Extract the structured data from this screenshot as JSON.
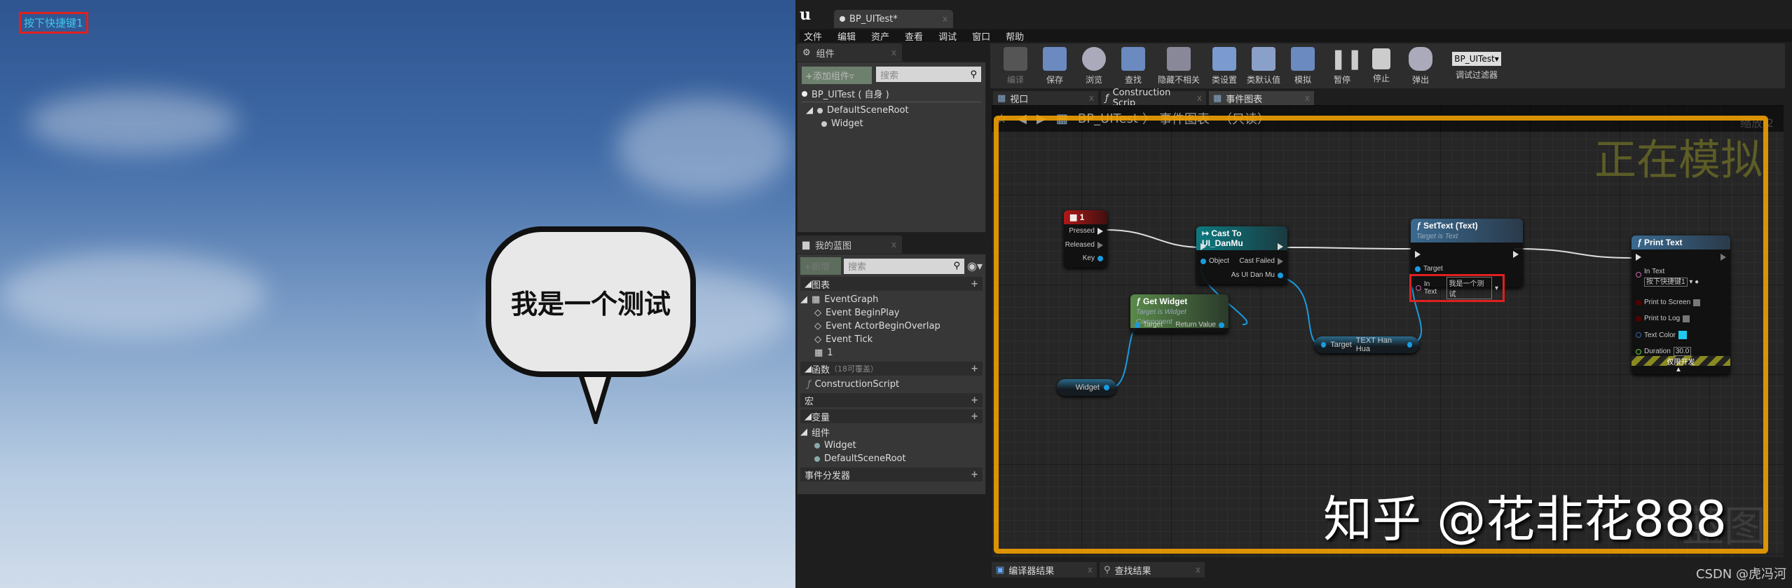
{
  "viewport": {
    "hint_text": "按下快捷键1",
    "bubble_text": "我是一个测试"
  },
  "editor": {
    "window_tab": "BP_UITest*",
    "menu": [
      "文件",
      "编辑",
      "资产",
      "查看",
      "调试",
      "窗口",
      "帮助"
    ],
    "components_panel": {
      "tab": "组件",
      "add_button": "+添加组件▿",
      "search_placeholder": "搜索",
      "self_item": "BP_UITest ( 自身 )",
      "tree": [
        "DefaultSceneRoot",
        "Widget"
      ]
    },
    "blueprint_panel": {
      "tab": "我的蓝图",
      "add_button": "+新增",
      "search_placeholder": "搜索",
      "sections": {
        "graphs": "图表",
        "functions": "函数",
        "functions_note": "（18可覆盖）",
        "macros": "宏",
        "variables": "变量",
        "components": "组件",
        "dispatchers": "事件分发器"
      },
      "graph_items": [
        "EventGraph",
        "Event BeginPlay",
        "Event ActorBeginOverlap",
        "Event Tick",
        "1"
      ],
      "function_items": [
        "ConstructionScript"
      ],
      "component_items": [
        "Widget",
        "DefaultSceneRoot"
      ]
    },
    "toolbar": {
      "buttons": [
        "编译",
        "保存",
        "浏览",
        "查找",
        "隐藏不相关",
        "类设置",
        "类默认值",
        "模拟",
        "暂停",
        "停止",
        "弹出"
      ],
      "debug_object": "BP_UITest▾",
      "debug_filter": "调试过滤器"
    },
    "doc_tabs": [
      "视口",
      "Construction Scrip",
      "事件图表"
    ],
    "breadcrumb": {
      "root": "BP_UITest",
      "sep": "〉",
      "current": "事件图表",
      "readonly": "（只读）"
    },
    "graph": {
      "zoom_label": "缩放-2",
      "simulating": "正在模拟",
      "watermark_corner": "蓝图",
      "key_node": {
        "title": "1",
        "pins": [
          "Pressed",
          "Released",
          "Key"
        ]
      },
      "cast_node": {
        "title": "Cast To UI_DanMu",
        "pins": [
          "Object",
          "Cast Failed",
          "As UI Dan Mu"
        ]
      },
      "get_widget": {
        "title": "Get Widget",
        "subtitle": "Target is Widget Component",
        "pins": [
          "Target",
          "Return Value"
        ]
      },
      "widget_var": "Widget",
      "text_var": {
        "left": "Target",
        "right": "TEXT Han Hua"
      },
      "set_text": {
        "title": "SetText (Text)",
        "subtitle": "Target is Text",
        "target": "Target",
        "in_text_label": "In Text",
        "in_text_value": "我是一个测试"
      },
      "print_text": {
        "title": "Print Text",
        "in_text_label": "In Text",
        "in_text_value": "按下快捷键1",
        "print_screen": "Print to Screen",
        "print_log": "Print to Log",
        "text_color": "Text Color",
        "duration_label": "Duration",
        "duration_value": "30.0",
        "dev_only": "仅限开发",
        "text_color_value": "#1ec8f0"
      }
    },
    "bottom_tabs": [
      "编译器结果",
      "查找结果"
    ],
    "overlay_watermark": "知乎 @花非花888",
    "credit": "CSDN @虎冯河"
  }
}
